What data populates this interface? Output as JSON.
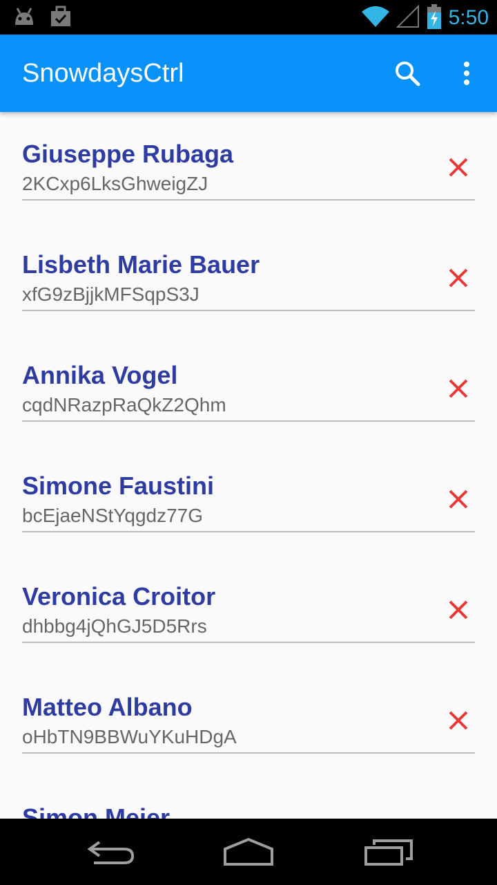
{
  "status_bar": {
    "time": "5:50",
    "icons": [
      "android-notification-icon",
      "briefcase-check-icon",
      "wifi-icon",
      "signal-icon",
      "battery-charging-icon"
    ]
  },
  "app_bar": {
    "title": "SnowdaysCtrl",
    "icons": [
      "search-icon",
      "overflow-menu-icon"
    ]
  },
  "colors": {
    "app_bar": "#0892f9",
    "name_text": "#2e3ba0",
    "delete_icon": "#e53935",
    "status_accent": "#33b5e5"
  },
  "list": {
    "items": [
      {
        "name": "Giuseppe Rubaga",
        "code": "2KCxp6LksGhweigZJ"
      },
      {
        "name": "Lisbeth Marie Bauer",
        "code": "xfG9zBjjkMFSqpS3J"
      },
      {
        "name": "Annika Vogel",
        "code": "cqdNRazpRaQkZ2Qhm"
      },
      {
        "name": "Simone Faustini",
        "code": "bcEjaeNStYqgdz77G"
      },
      {
        "name": "Veronica Croitor",
        "code": "dhbbg4jQhGJ5D5Rrs"
      },
      {
        "name": "Matteo Albano",
        "code": "oHbTN9BBWuYKuHDgA"
      },
      {
        "name": "Simon Meier",
        "code": ""
      }
    ]
  },
  "nav_bar": {
    "icons": [
      "back-icon",
      "home-icon",
      "recents-icon"
    ]
  }
}
